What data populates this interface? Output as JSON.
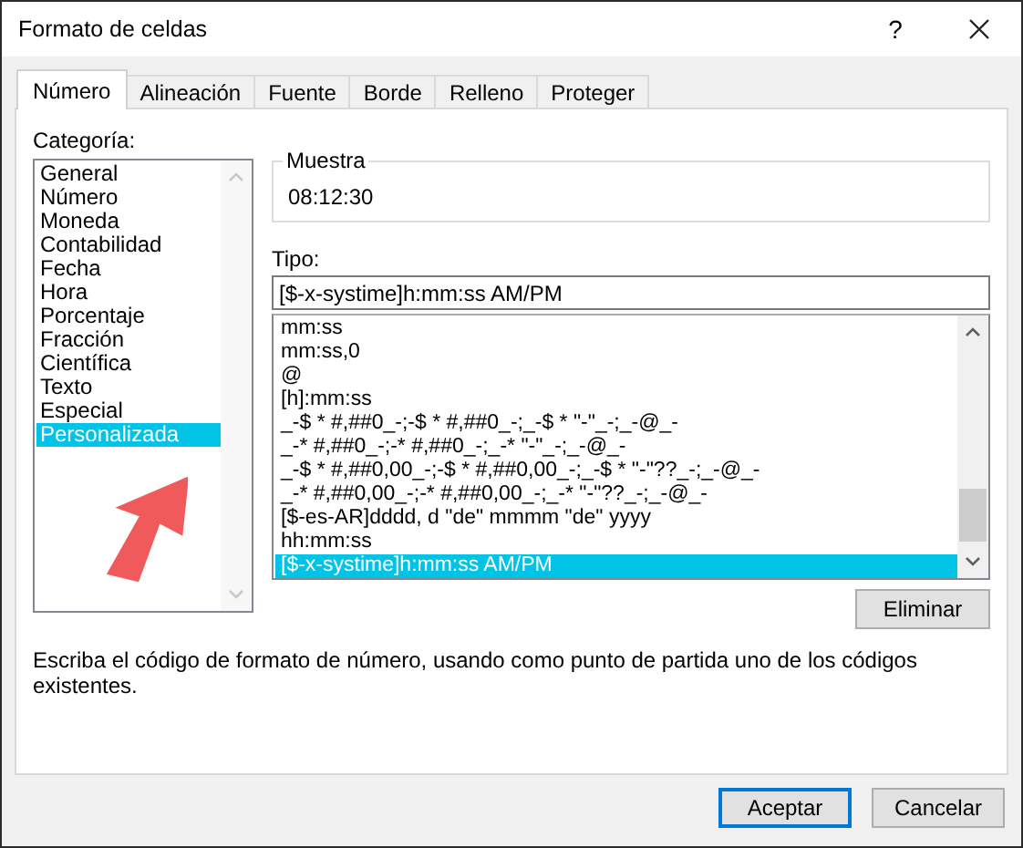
{
  "window": {
    "title": "Formato de celdas",
    "help": "?"
  },
  "tabs": [
    {
      "label": "Número",
      "selected": true
    },
    {
      "label": "Alineación",
      "selected": false
    },
    {
      "label": "Fuente",
      "selected": false
    },
    {
      "label": "Borde",
      "selected": false
    },
    {
      "label": "Relleno",
      "selected": false
    },
    {
      "label": "Proteger",
      "selected": false
    }
  ],
  "category": {
    "label": "Categoría:",
    "items": [
      {
        "label": "General",
        "selected": false
      },
      {
        "label": "Número",
        "selected": false
      },
      {
        "label": "Moneda",
        "selected": false
      },
      {
        "label": "Contabilidad",
        "selected": false
      },
      {
        "label": "Fecha",
        "selected": false
      },
      {
        "label": "Hora",
        "selected": false
      },
      {
        "label": "Porcentaje",
        "selected": false
      },
      {
        "label": "Fracción",
        "selected": false
      },
      {
        "label": "Científica",
        "selected": false
      },
      {
        "label": "Texto",
        "selected": false
      },
      {
        "label": "Especial",
        "selected": false
      },
      {
        "label": "Personalizada",
        "selected": true
      }
    ]
  },
  "sample": {
    "label": "Muestra",
    "value": "08:12:30"
  },
  "type": {
    "label": "Tipo:",
    "value": "[$-x-systime]h:mm:ss AM/PM",
    "items": [
      {
        "label": "mm:ss",
        "selected": false
      },
      {
        "label": "mm:ss,0",
        "selected": false
      },
      {
        "label": "@",
        "selected": false
      },
      {
        "label": "[h]:mm:ss",
        "selected": false
      },
      {
        "label": "_-$ * #,##0_-;-$ * #,##0_-;_-$ * \"-\"_-;_-@_-",
        "selected": false
      },
      {
        "label": "_-* #,##0_-;-* #,##0_-;_-* \"-\"_-;_-@_-",
        "selected": false
      },
      {
        "label": "_-$ * #,##0,00_-;-$ * #,##0,00_-;_-$ * \"-\"??_-;_-@_-",
        "selected": false
      },
      {
        "label": "_-* #,##0,00_-;-* #,##0,00_-;_-* \"-\"??_-;_-@_-",
        "selected": false
      },
      {
        "label": "[$-es-AR]dddd, d \"de\" mmmm \"de\" yyyy",
        "selected": false
      },
      {
        "label": "hh:mm:ss",
        "selected": false
      },
      {
        "label": "[$-x-systime]h:mm:ss AM/PM",
        "selected": true
      }
    ]
  },
  "delete_button": "Eliminar",
  "description": "Escriba el código de formato de número, usando como punto de partida uno de los códigos existentes.",
  "buttons": [
    {
      "label": "Aceptar",
      "default": true
    },
    {
      "label": "Cancelar",
      "default": false
    }
  ]
}
